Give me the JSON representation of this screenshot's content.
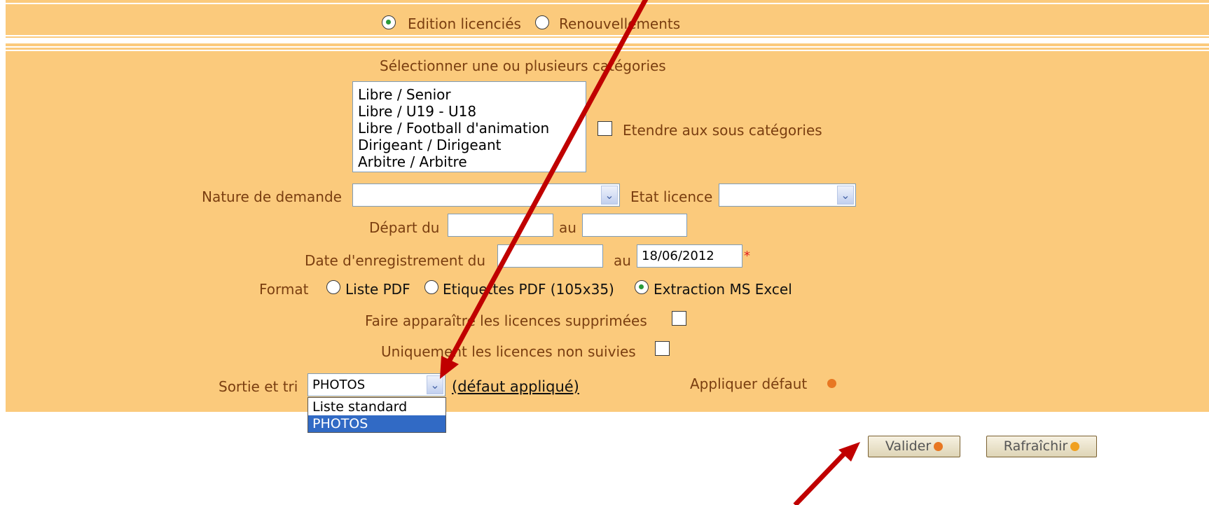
{
  "mode": {
    "edition_label": "Edition licenciés",
    "renewals_label": "Renouvellements",
    "selected": "edition"
  },
  "categories": {
    "title": "Sélectionner une ou plusieurs catégories",
    "items": [
      "Libre / Senior",
      "Libre / U19 - U18",
      "Libre / Football d'animation",
      "Dirigeant / Dirigeant",
      "Arbitre / Arbitre"
    ],
    "extend_label": "Etendre aux sous catégories"
  },
  "filters": {
    "nature_label": "Nature de demande",
    "nature_value": "",
    "etat_label": "Etat licence",
    "etat_value": "",
    "depart_label": "Départ du",
    "depart_from": "",
    "depart_to_label": "au",
    "depart_to": "",
    "registration_label": "Date d'enregistrement du",
    "registration_from": "",
    "registration_to_label": "au",
    "registration_to": "18/06/2012",
    "required_marker": "*"
  },
  "format": {
    "label": "Format",
    "options": [
      "Liste PDF",
      "Etiquettes PDF (105x35)",
      "Extraction MS Excel"
    ],
    "selected": "Extraction MS Excel"
  },
  "options": {
    "show_deleted_label": "Faire apparaître les licences supprimées",
    "only_unfollowed_label": "Uniquement les licences non suivies"
  },
  "output": {
    "label": "Sortie et tri",
    "value": "PHOTOS",
    "default_link": "(défaut appliqué)",
    "apply_default_label": "Appliquer défaut",
    "dropdown_options": [
      "Liste standard",
      "PHOTOS"
    ],
    "dropdown_selected": "PHOTOS"
  },
  "actions": {
    "validate_label": "Valider",
    "refresh_label": "Rafraîchir"
  },
  "colors": {
    "panel": "#fbca7c",
    "label_text": "#7a3e10",
    "annotation_arrow": "#c00000",
    "selection_highlight": "#316ac5"
  }
}
